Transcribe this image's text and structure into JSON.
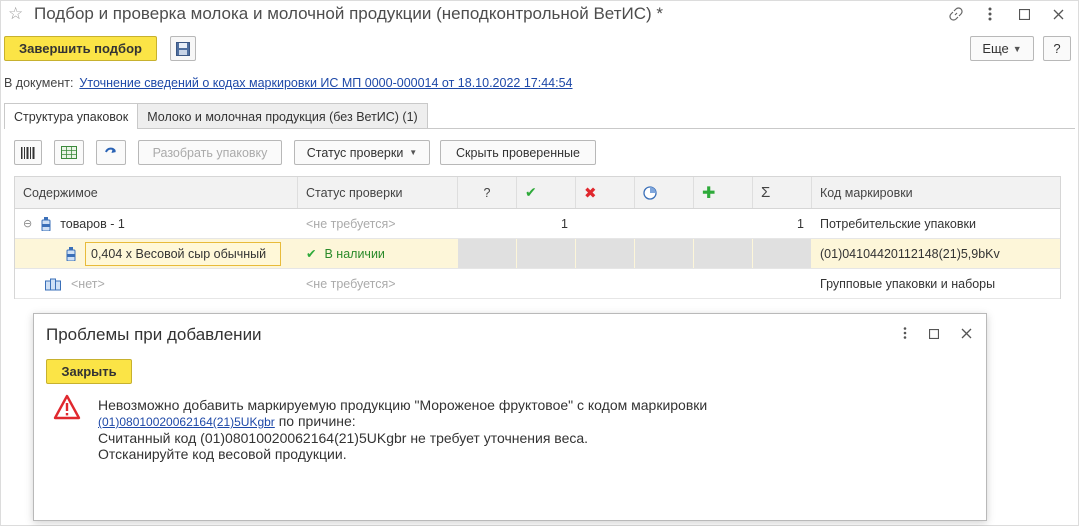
{
  "window": {
    "title": "Подбор и проверка молока и молочной продукции (неподконтрольной ВетИС) *"
  },
  "toolbar": {
    "finish_label": "Завершить подбор",
    "more_label": "Еще",
    "help_label": "?"
  },
  "document": {
    "label": "В документ:",
    "link": "Уточнение сведений о кодах маркировки ИС МП 0000-000014 от 18.10.2022 17:44:54"
  },
  "tabs": [
    {
      "label": "Структура упаковок",
      "active": true
    },
    {
      "label": "Молоко и молочная продукция (без ВетИС) (1)",
      "active": false
    }
  ],
  "grid_tools": {
    "unpack_label": "Разобрать упаковку",
    "status_label": "Статус проверки",
    "hide_checked_label": "Скрыть проверенные"
  },
  "grid": {
    "columns": {
      "content": "Содержимое",
      "status": "Статус проверки",
      "question": "?",
      "sum": "Σ",
      "code": "Код маркировки"
    },
    "rows": [
      {
        "content": "товаров - 1",
        "status": "<не требуется>",
        "ok": "1",
        "sum": "1",
        "code": "Потребительские упаковки"
      },
      {
        "content": "0,404 х Весовой сыр обычный",
        "status": "В наличии",
        "code": "(01)04104420112148(21)5,9bKv"
      },
      {
        "content": "<нет>",
        "status": "<не требуется>",
        "code": "Групповые упаковки и наборы"
      }
    ]
  },
  "dialog": {
    "title": "Проблемы при добавлении",
    "close_label": "Закрыть",
    "line1": "Невозможно добавить маркируемую продукцию \"Мороженое фруктовое\" с кодом маркировки",
    "code_link": "(01)08010020062164(21)5UKgbr",
    "line2_suffix": " по причине:",
    "line3": "Считанный код (01)08010020062164(21)5UKgbr не требует уточнения веса.",
    "line4": "Отсканируйте код весовой продукции."
  },
  "colors": {
    "accent_yellow": "#fbe446",
    "link_blue": "#1e49a8",
    "ok_green": "#2eaa3a",
    "error_red": "#e0282e"
  }
}
